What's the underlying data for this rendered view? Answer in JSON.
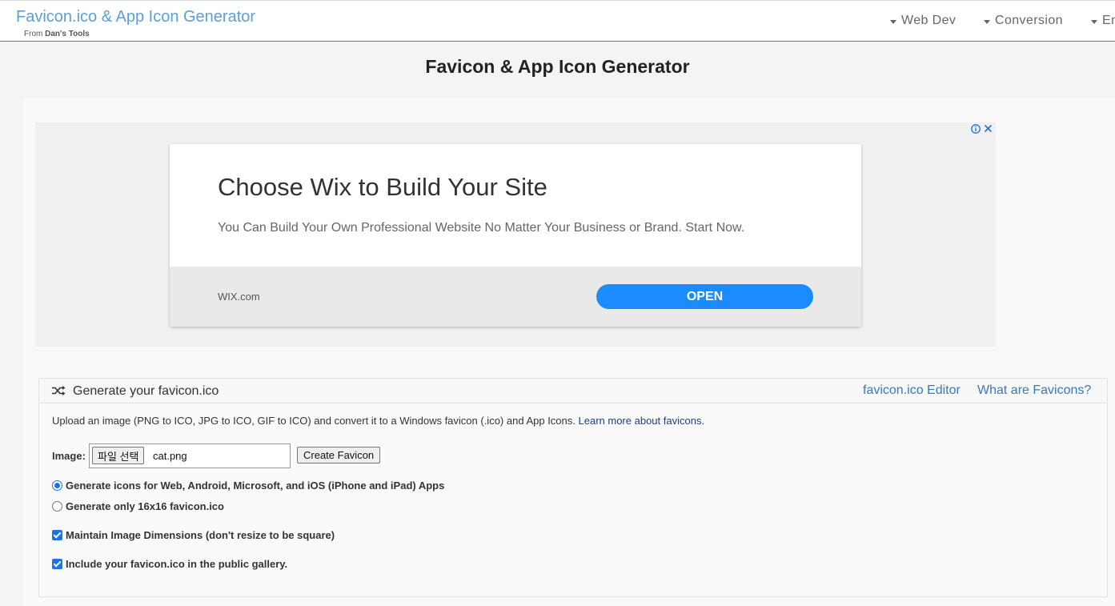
{
  "nav": {
    "brand": "Favicon.ico & App Icon Generator",
    "brand_sub_prefix": "From",
    "brand_sub_name": "Dan's Tools",
    "menus": [
      "Web Dev",
      "Conversion",
      "En"
    ]
  },
  "page_title": "Favicon & App Icon Generator",
  "ad": {
    "headline": "Choose Wix to Build Your Site",
    "body": "You Can Build Your Own Professional Website No Matter Your Business or Brand. Start Now.",
    "domain": "WIX.com",
    "cta": "OPEN",
    "choices_info": "i",
    "choices_close": "✕"
  },
  "panel": {
    "title": "Generate your favicon.ico",
    "links": [
      "favicon.ico Editor",
      "What are Favicons?"
    ],
    "intro": "Upload an image (PNG to ICO, JPG to ICO, GIF to ICO) and convert it to a Windows favicon (.ico) and App Icons.",
    "intro_link": "Learn more about favicons",
    "intro_end": ".",
    "image_label": "Image:",
    "file_button": "파일 선택",
    "file_name": "cat.png",
    "create_button": "Create Favicon",
    "options": [
      {
        "type": "radio",
        "checked": true,
        "label": "Generate icons for Web, Android, Microsoft, and iOS (iPhone and iPad) Apps"
      },
      {
        "type": "radio",
        "checked": false,
        "label": "Generate only 16x16 favicon.ico"
      },
      {
        "type": "checkbox",
        "checked": true,
        "label": "Maintain Image Dimensions (don't resize to be square)"
      },
      {
        "type": "checkbox",
        "checked": true,
        "label": "Include your favicon.ico in the public gallery."
      }
    ]
  },
  "colors": {
    "brand": "#5b9fd6",
    "link": "#3a7ab8",
    "accent": "#1a73e8",
    "ad_button": "#1a8cff"
  }
}
